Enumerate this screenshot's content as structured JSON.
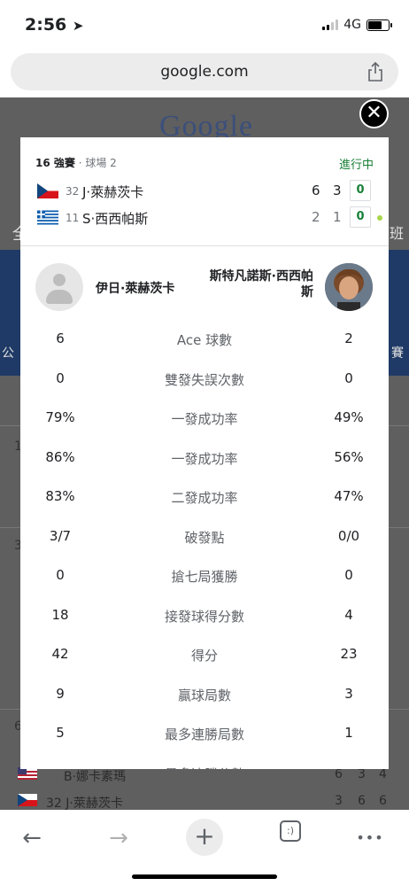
{
  "status_bar": {
    "time": "2:56",
    "network": "4G"
  },
  "browser": {
    "url": "google.com"
  },
  "background": {
    "logo": "Google",
    "fragments": [
      "全",
      "班",
      "公",
      "賽",
      "1",
      "3",
      "6",
      "B·娜卡素瑪",
      "32 J·萊赫茨卡"
    ],
    "rows": [
      {
        "name": "B·娜卡素瑪",
        "scores": [
          "6",
          "3",
          "4"
        ]
      },
      {
        "name": "32 J·萊赫茨卡",
        "scores": [
          "3",
          "6",
          "6"
        ]
      }
    ]
  },
  "match": {
    "round": "16 強賽",
    "court": "· 球場 2",
    "status": "進行中",
    "players": [
      {
        "seed": "32",
        "name": "J·萊赫茨卡",
        "set1": "6",
        "set2": "3",
        "set3": "0",
        "country": "Czech Republic"
      },
      {
        "seed": "11",
        "name": "S·西西帕斯",
        "set1": "2",
        "set2": "1",
        "set3": "0",
        "country": "Greece"
      }
    ]
  },
  "stats_header": {
    "left_name": "伊日·萊赫茨卡",
    "right_name": "斯特凡諾斯·西西帕斯"
  },
  "stats": [
    {
      "left": "6",
      "label": "Ace 球數",
      "right": "2"
    },
    {
      "left": "0",
      "label": "雙發失誤次數",
      "right": "0"
    },
    {
      "left": "79%",
      "label": "一發成功率",
      "right": "49%"
    },
    {
      "left": "86%",
      "label": "一發成功率",
      "right": "56%"
    },
    {
      "left": "83%",
      "label": "二發成功率",
      "right": "47%"
    },
    {
      "left": "3/7",
      "label": "破發點",
      "right": "0/0"
    },
    {
      "left": "0",
      "label": "搶七局獲勝",
      "right": "0"
    },
    {
      "left": "18",
      "label": "接發球得分數",
      "right": "4"
    },
    {
      "left": "42",
      "label": "得分",
      "right": "23"
    },
    {
      "left": "9",
      "label": "贏球局數",
      "right": "3"
    },
    {
      "left": "5",
      "label": "最多連勝局數",
      "right": "1"
    },
    {
      "left": "",
      "label": "最多連勝分數",
      "right": ""
    }
  ],
  "toolbar": {
    "back": "←",
    "forward": "→",
    "new_tab": "+",
    "tabs": ":)",
    "more": "•••"
  },
  "colors": {
    "live_green": "#188038",
    "card_bg": "#ffffff",
    "overlay": "#5f5f5f"
  }
}
